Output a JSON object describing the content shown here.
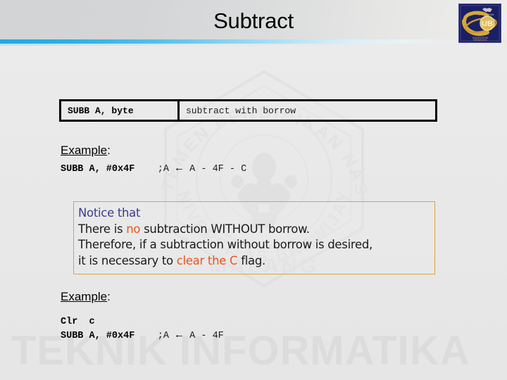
{
  "slide": {
    "title": "Subtract",
    "background_color": "#e9e9e9",
    "accent_color": "#1fa9e4"
  },
  "logo": {
    "name": "universitas-brawijaya-logo",
    "text": "UB",
    "background_color": "#1b1f63",
    "emblem_color": "#d8a93a"
  },
  "watermarks": {
    "seal_text_top": "DEPARTEMEN PENDIDIKAN NASIONAL",
    "seal_text_bottom": "UNIVERSITAS BRAWIJAYA",
    "seal_city": "MALANG",
    "bottom_text": "TEKNIK INFORMATIKA"
  },
  "instruction_table": {
    "mnemonic": "SUBB A, byte",
    "description": "subtract with borrow"
  },
  "example_1": {
    "label": "Example",
    "label_colon": ":",
    "code": "SUBB A, #0x4F",
    "gap": "    ",
    "comment_prefix": ";A ",
    "arrow": "←",
    "comment_rest": " A - 4F - C"
  },
  "notice": {
    "border_color": "#d9a441",
    "head_color": "#3b3b8f",
    "highlight_color": "#e8551f",
    "line1": "Notice that",
    "line2_a": "There is ",
    "line2_hl": "no",
    "line2_b": " subtraction WITHOUT borrow.",
    "line3": "Therefore, if a subtraction without borrow is desired,",
    "line4_a": "it is necessary to ",
    "line4_hl": "clear the C",
    "line4_b": " flag."
  },
  "example_2": {
    "label": "Example",
    "label_colon": ":",
    "code_line1": "Clr  c",
    "code_line2": "SUBB A, #0x4F",
    "gap": "    ",
    "comment_prefix": ";A ",
    "arrow": "←",
    "comment_rest": " A - 4F"
  }
}
